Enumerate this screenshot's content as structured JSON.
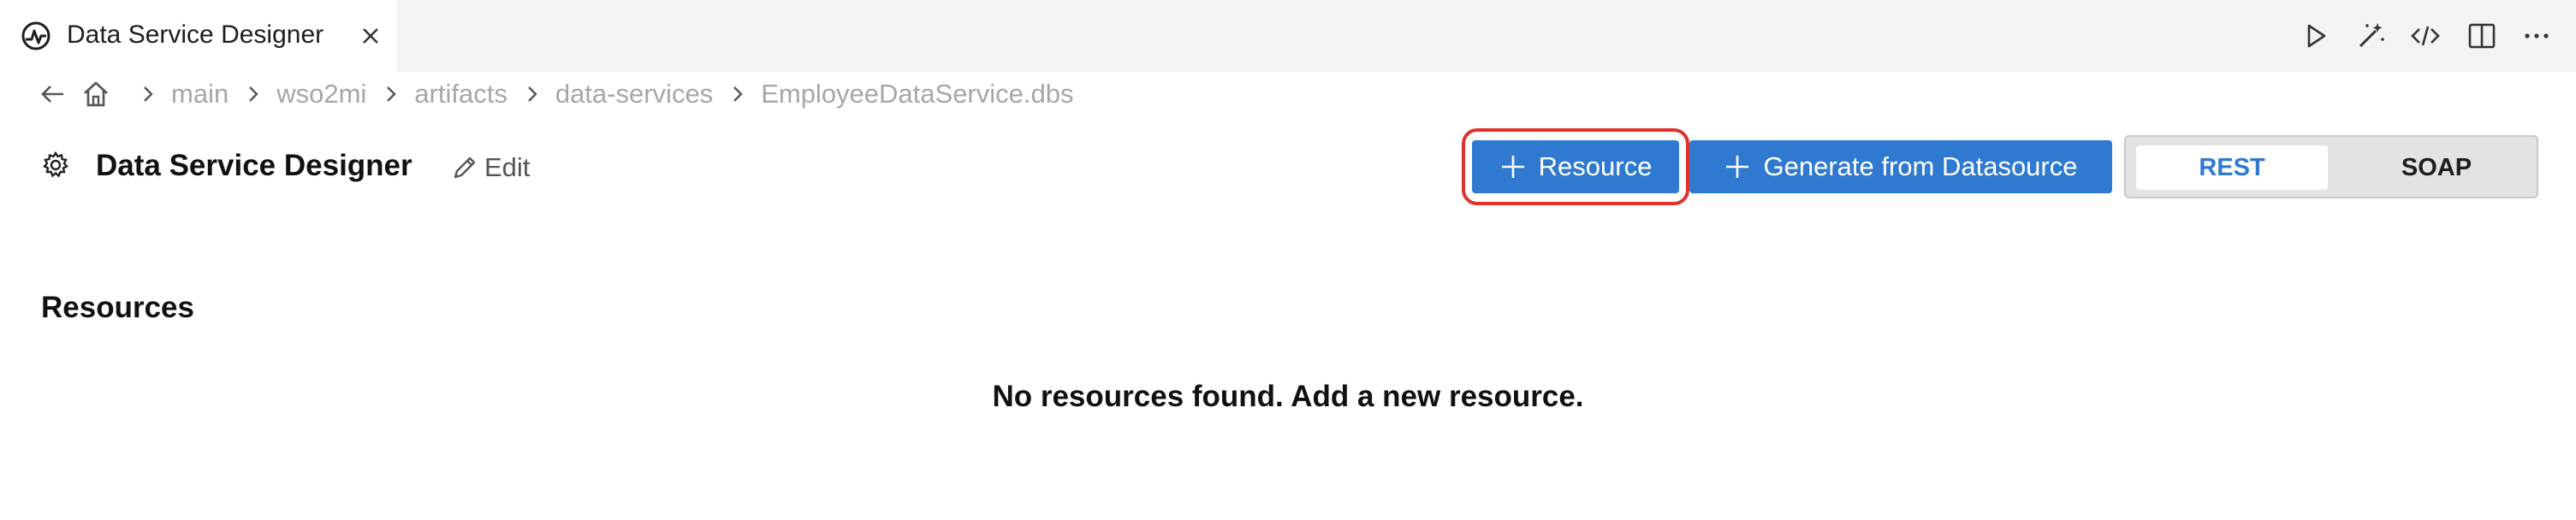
{
  "tab": {
    "title": "Data Service Designer",
    "icon": "wso2mi-icon"
  },
  "toolbar": {
    "actions": [
      "run-icon",
      "magic-wand-icon",
      "code-icon",
      "split-editor-icon",
      "more-icon"
    ]
  },
  "breadcrumb": {
    "items": [
      "main",
      "wso2mi",
      "artifacts",
      "data-services",
      "EmployeeDataService.dbs"
    ]
  },
  "header": {
    "title": "Data Service Designer",
    "edit_label": "Edit",
    "resource_button": "Resource",
    "generate_button": "Generate from Datasource",
    "segments": {
      "rest": "REST",
      "soap": "SOAP",
      "selected": "REST"
    }
  },
  "resources": {
    "title": "Resources",
    "empty_message": "No resources found. Add a new resource."
  },
  "colors": {
    "accent": "#2f7ad0",
    "highlight": "#e0322c"
  }
}
